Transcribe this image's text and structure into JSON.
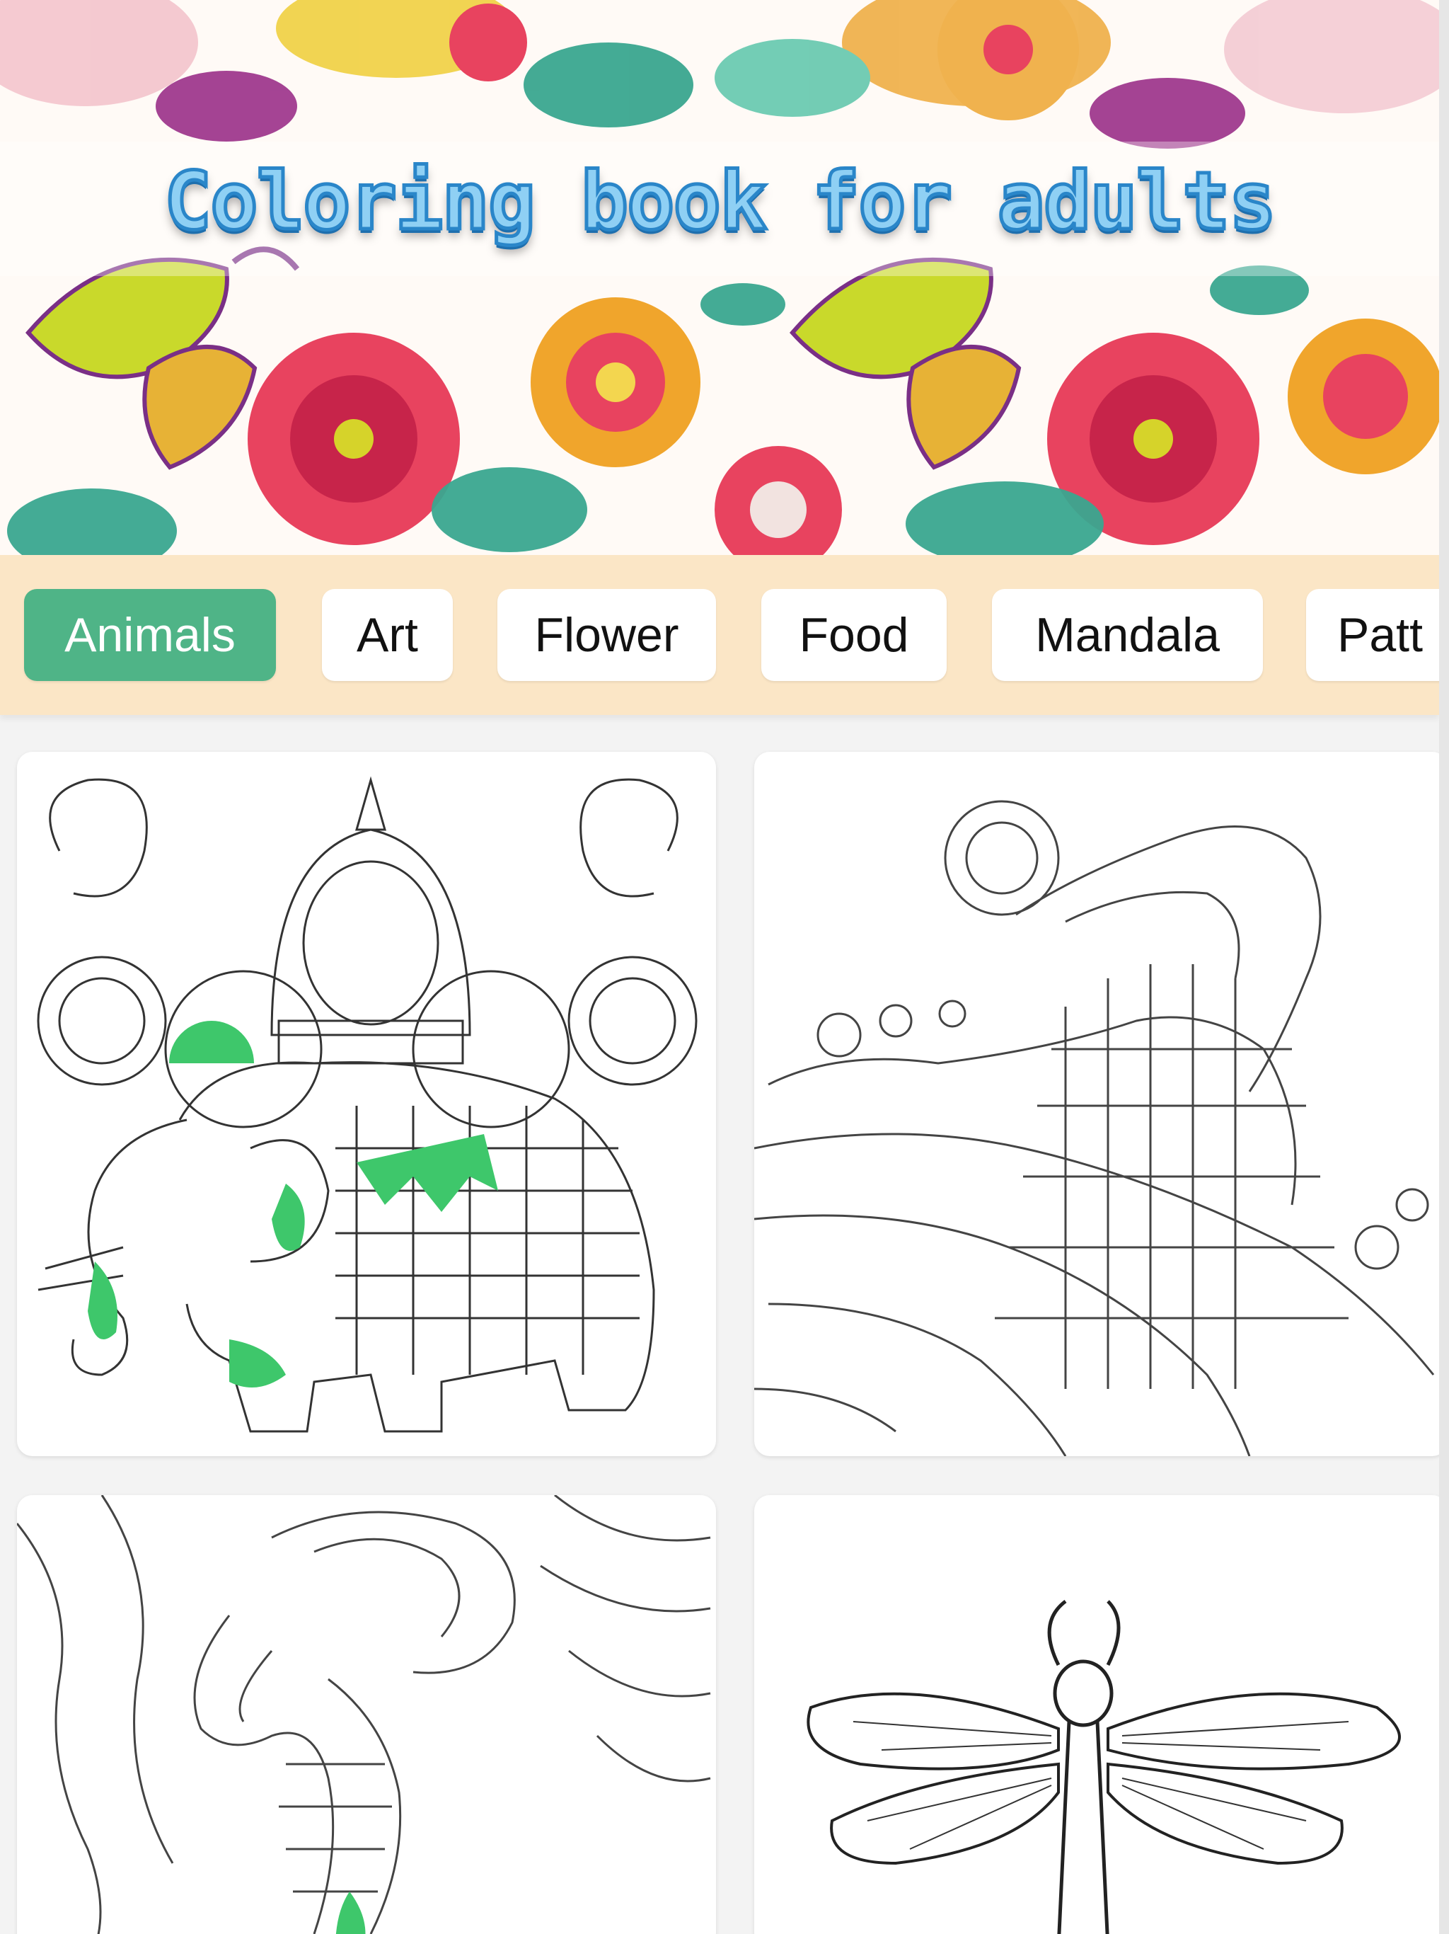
{
  "banner": {
    "title": "Coloring book for adults"
  },
  "categories": {
    "selected": "Animals",
    "items": [
      "Animals",
      "Art",
      "Flower",
      "Food",
      "Mandala",
      "Patt"
    ]
  },
  "gallery": {
    "items": [
      {
        "name": "elephant",
        "icon": "elephant-drawing"
      },
      {
        "name": "peacock",
        "icon": "peacock-drawing"
      },
      {
        "name": "seahorse",
        "icon": "seahorse-drawing"
      },
      {
        "name": "dragonfly",
        "icon": "dragonfly-drawing"
      }
    ]
  },
  "colors": {
    "category_bar": "#fbe6c6",
    "active_chip": "#4fb487",
    "fill_green": "#3ec76b",
    "title_fill": "#8fd0f4",
    "title_stroke": "#2a86c9"
  }
}
